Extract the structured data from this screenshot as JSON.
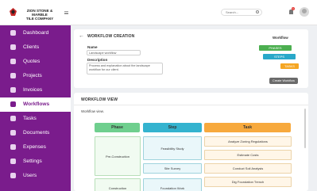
{
  "header": {
    "company_line1": "ZION STONE & MARBLE",
    "company_line2": "TILE COMPANY",
    "search_placeholder": "Search...",
    "notification_count": "1"
  },
  "sidebar": {
    "items": [
      {
        "label": "Dashboard",
        "icon": "dashboard-icon",
        "active": false
      },
      {
        "label": "Clients",
        "icon": "clients-icon",
        "active": false
      },
      {
        "label": "Quotes",
        "icon": "quotes-icon",
        "active": false
      },
      {
        "label": "Projects",
        "icon": "projects-icon",
        "active": false
      },
      {
        "label": "Invoices",
        "icon": "invoices-icon",
        "active": false
      },
      {
        "label": "Workflows",
        "icon": "workflows-icon",
        "active": true
      },
      {
        "label": "Tasks",
        "icon": "tasks-icon",
        "active": false
      },
      {
        "label": "Documents",
        "icon": "documents-icon",
        "active": false
      },
      {
        "label": "Expenses",
        "icon": "expenses-icon",
        "active": false
      },
      {
        "label": "Settings",
        "icon": "settings-icon",
        "active": false
      },
      {
        "label": "Users",
        "icon": "users-icon",
        "active": false
      }
    ]
  },
  "workflow_creation": {
    "title": "WORKFLOW CREATION",
    "name_label": "Name",
    "name_value": "Landscape workflow",
    "description_label": "Description",
    "description_value": "Process and explanation about the landscape workflow for our client.",
    "workflow_label": "Workflow",
    "chips": [
      {
        "label": "PHASES",
        "color": "#4caf50"
      },
      {
        "label": "STEPS",
        "color": "#29a8c9"
      },
      {
        "label": "TASKS",
        "color": "#f5a623"
      }
    ],
    "create_button": "Create Workflow"
  },
  "workflow_view": {
    "title": "WORKFLOW VIEW",
    "subtitle": "Workflow view.",
    "columns": [
      {
        "label": "Phase",
        "color": "#6fcf8e"
      },
      {
        "label": "Step",
        "color": "#34b3cf"
      },
      {
        "label": "Task",
        "color": "#f7a93d"
      }
    ],
    "phases": [
      "Pre-Construction",
      "Construction"
    ],
    "steps": [
      "Feasibility Study",
      "Site Survey",
      "Foundation Work"
    ],
    "tasks": [
      "Analyze Zoning Regulations",
      "Estimate Costs",
      "Conduct Soil Analysis",
      "Dig Foundation Trench"
    ]
  },
  "colors": {
    "sidebar_bg": "#7a1c8c",
    "accent": "#7a1c8c"
  }
}
